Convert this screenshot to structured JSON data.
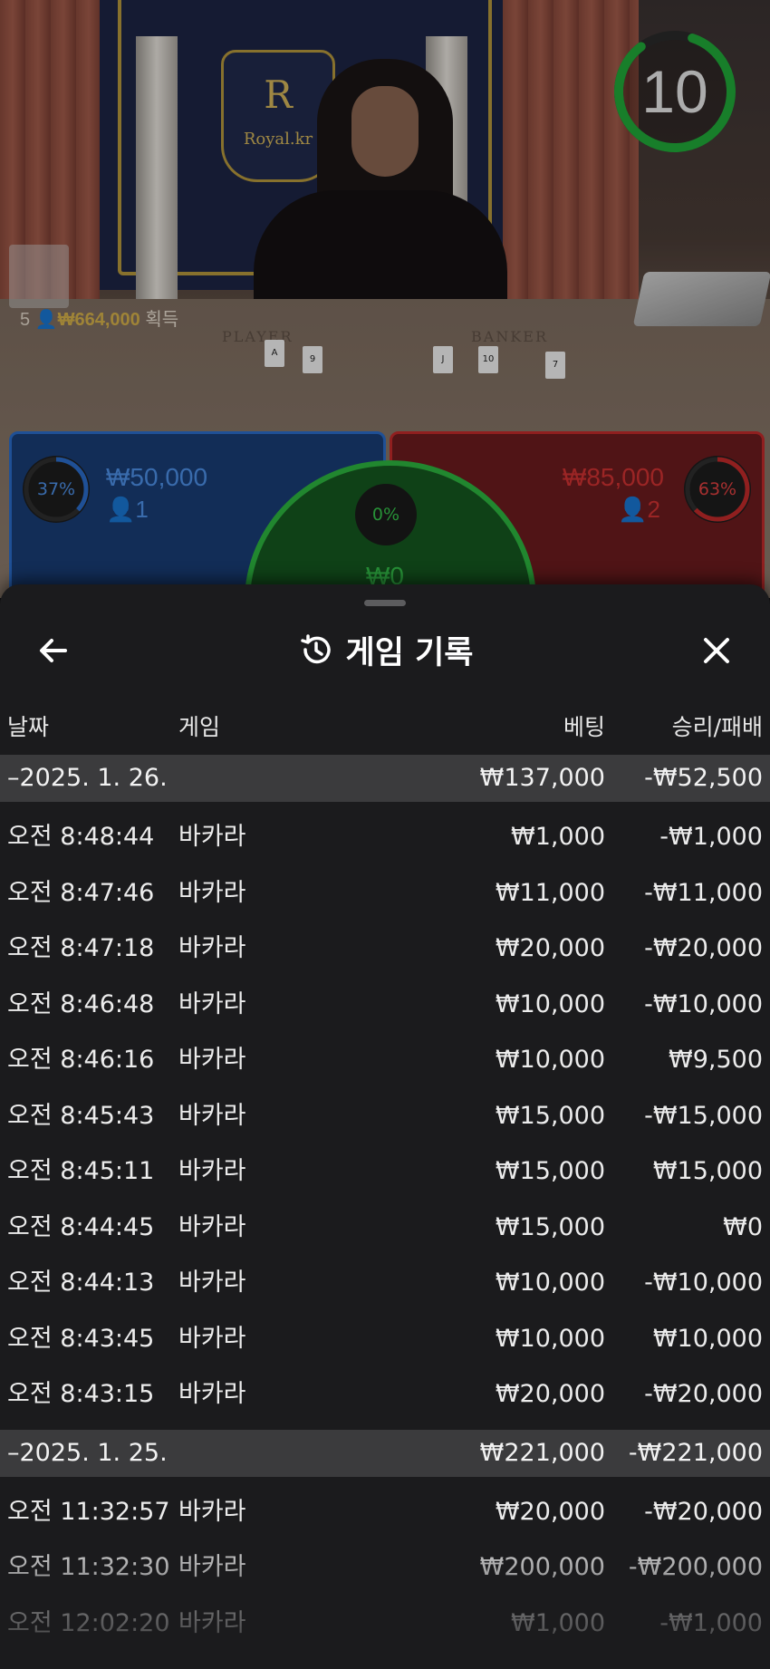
{
  "stage": {
    "logo_letter": "R",
    "logo_text": "Royal.kr",
    "felt_player": "PLAYER",
    "felt_banker": "BANKER",
    "timer": "10",
    "winnings_count": "5",
    "winnings_amount": "₩664,000",
    "winnings_label": "획득"
  },
  "bets": {
    "player": {
      "percent": "37%",
      "amount": "₩50,000",
      "users": "1",
      "color": "#2a6bc8"
    },
    "tie": {
      "percent": "0%",
      "amount": "₩0",
      "color": "#2db43f"
    },
    "banker": {
      "percent": "63%",
      "amount": "₩85,000",
      "users": "2",
      "color": "#c12a2a"
    }
  },
  "sheet": {
    "title": "게임 기록",
    "columns": {
      "date": "날짜",
      "game": "게임",
      "bet": "베팅",
      "result": "승리/패배"
    },
    "groups": [
      {
        "date": "–2025. 1. 26.",
        "bet_total": "₩137,000",
        "result_total": "-₩52,500",
        "rows": [
          {
            "time": "오전 8:48:44",
            "game": "바카라",
            "bet": "₩1,000",
            "result": "-₩1,000"
          },
          {
            "time": "오전 8:47:46",
            "game": "바카라",
            "bet": "₩11,000",
            "result": "-₩11,000"
          },
          {
            "time": "오전 8:47:18",
            "game": "바카라",
            "bet": "₩20,000",
            "result": "-₩20,000"
          },
          {
            "time": "오전 8:46:48",
            "game": "바카라",
            "bet": "₩10,000",
            "result": "-₩10,000"
          },
          {
            "time": "오전 8:46:16",
            "game": "바카라",
            "bet": "₩10,000",
            "result": "₩9,500"
          },
          {
            "time": "오전 8:45:43",
            "game": "바카라",
            "bet": "₩15,000",
            "result": "-₩15,000"
          },
          {
            "time": "오전 8:45:11",
            "game": "바카라",
            "bet": "₩15,000",
            "result": "₩15,000"
          },
          {
            "time": "오전 8:44:45",
            "game": "바카라",
            "bet": "₩15,000",
            "result": "₩0"
          },
          {
            "time": "오전 8:44:13",
            "game": "바카라",
            "bet": "₩10,000",
            "result": "-₩10,000"
          },
          {
            "time": "오전 8:43:45",
            "game": "바카라",
            "bet": "₩10,000",
            "result": "₩10,000"
          },
          {
            "time": "오전 8:43:15",
            "game": "바카라",
            "bet": "₩20,000",
            "result": "-₩20,000"
          }
        ]
      },
      {
        "date": "–2025. 1. 25.",
        "bet_total": "₩221,000",
        "result_total": "-₩221,000",
        "rows": [
          {
            "time": "오전 11:32:57",
            "game": "바카라",
            "bet": "₩20,000",
            "result": "-₩20,000"
          },
          {
            "time": "오전 11:32:30",
            "game": "바카라",
            "bet": "₩200,000",
            "result": "-₩200,000"
          },
          {
            "time": "오전 12:02:20",
            "game": "바카라",
            "bet": "₩1,000",
            "result": "-₩1,000"
          }
        ]
      }
    ]
  }
}
